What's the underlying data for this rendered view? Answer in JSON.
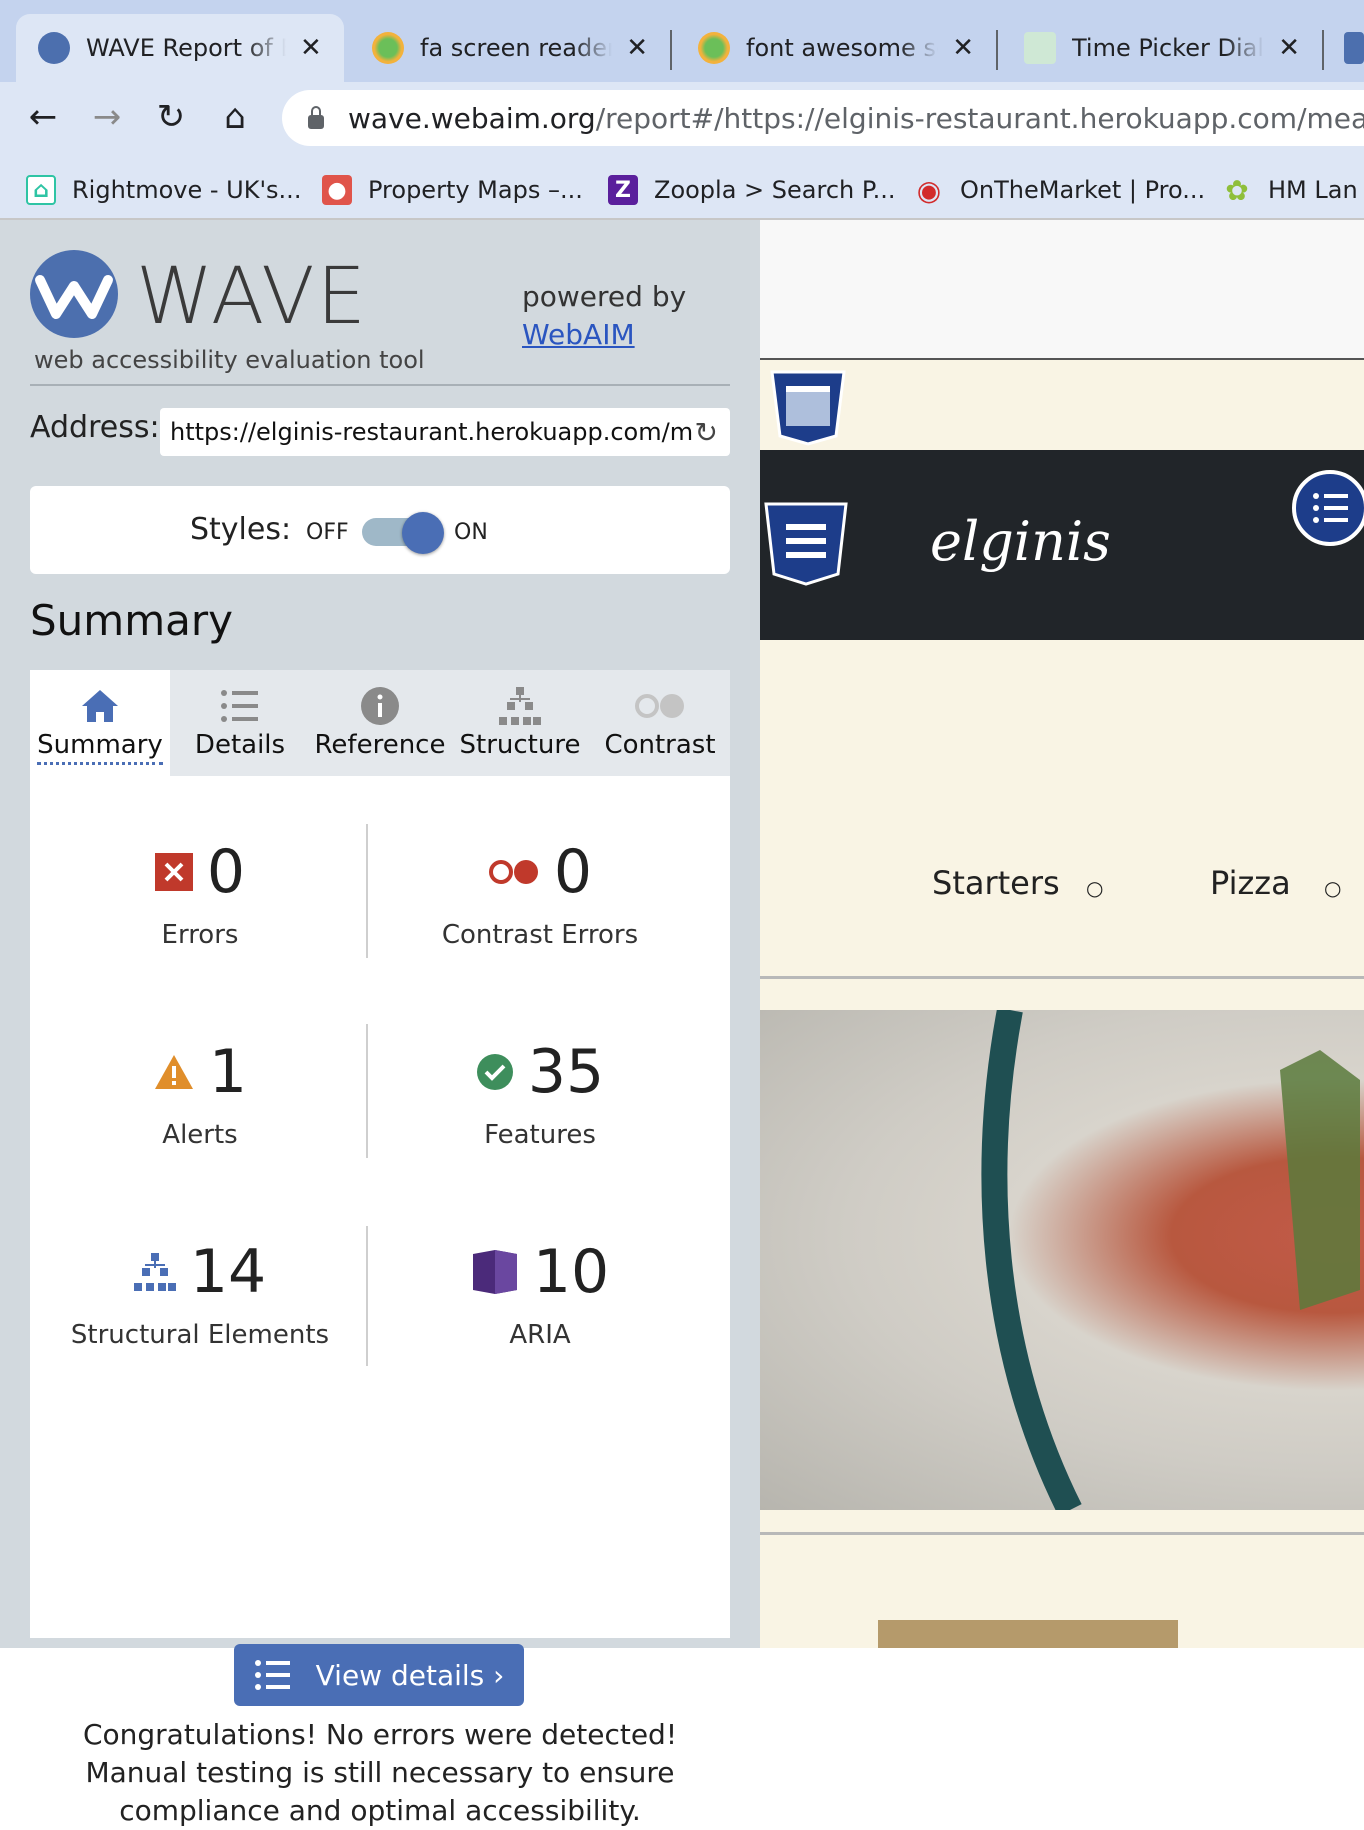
{
  "browser": {
    "tabs": [
      {
        "title": "WAVE Report of E",
        "active": true
      },
      {
        "title": "fa screen reader o",
        "active": false
      },
      {
        "title": "font awesome scr",
        "active": false
      },
      {
        "title": "Time Picker Dialog",
        "active": false
      }
    ],
    "url_host": "wave.webaim.org",
    "url_path": "/report#/https://elginis-restaurant.herokuapp.com/meals/",
    "bookmarks": [
      {
        "label": "Rightmove - UK's...",
        "icon": "house-icon",
        "color": "#2ec4a4"
      },
      {
        "label": "Property Maps –...",
        "icon": "map-pin-icon",
        "color": "#e0544a"
      },
      {
        "label": "Zoopla > Search P...",
        "icon": "zoopla-icon",
        "color": "#5a1f9c"
      },
      {
        "label": "OnTheMarket | Pro...",
        "icon": "location-icon",
        "color": "#d22b2b"
      },
      {
        "label": "HM Lan",
        "icon": "crest-icon",
        "color": "#8fbf3a"
      }
    ]
  },
  "wave": {
    "logo_word": "WAVE",
    "logo_sub": "web accessibility evaluation tool",
    "powered_by": "powered by",
    "webaim_link": "WebAIM",
    "address_label": "Address:",
    "address_value": "https://elginis-restaurant.herokuapp.com/m",
    "styles_label": "Styles:",
    "styles_off": "OFF",
    "styles_on": "ON",
    "styles_state": "on",
    "summary_heading": "Summary",
    "tabs": [
      {
        "label": "Summary",
        "icon": "home-icon"
      },
      {
        "label": "Details",
        "icon": "list-icon"
      },
      {
        "label": "Reference",
        "icon": "info-icon"
      },
      {
        "label": "Structure",
        "icon": "hierarchy-icon"
      },
      {
        "label": "Contrast",
        "icon": "contrast-icon"
      }
    ],
    "stats": {
      "errors": {
        "value": "0",
        "label": "Errors"
      },
      "contrast": {
        "value": "0",
        "label": "Contrast Errors"
      },
      "alerts": {
        "value": "1",
        "label": "Alerts"
      },
      "features": {
        "value": "35",
        "label": "Features"
      },
      "structural": {
        "value": "14",
        "label": "Structural Elements"
      },
      "aria": {
        "value": "10",
        "label": "ARIA"
      }
    },
    "view_details": "View details ›",
    "congrats": "Congratulations! No errors were detected! Manual testing is still necessary to ensure compliance and optimal accessibility.",
    "colors": {
      "accent": "#4a6eb5",
      "error": "#c0392b",
      "alert": "#e08e2b",
      "feature": "#3e8e5c",
      "aria": "#4b2a7a"
    }
  },
  "site": {
    "brand": "elginis",
    "menu": [
      "Starters",
      "Pizza"
    ]
  }
}
